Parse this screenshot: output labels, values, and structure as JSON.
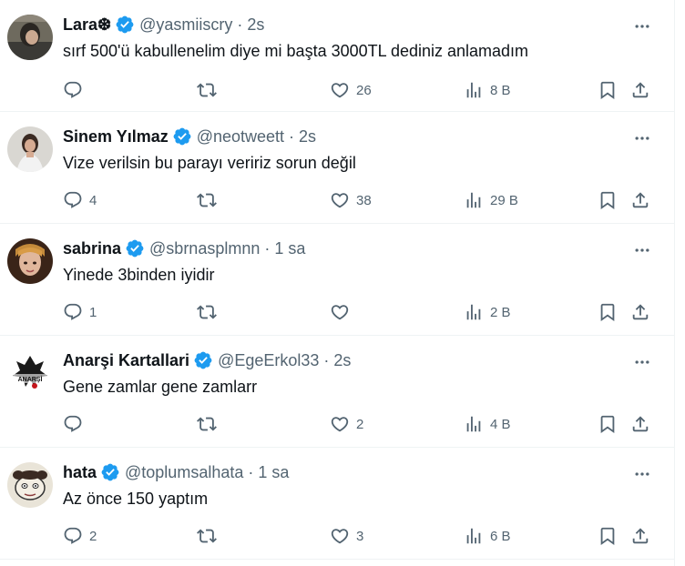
{
  "colors": {
    "text": "#0f1419",
    "secondary": "#536471",
    "verified": "#1d9bf0",
    "divider": "#eff3f4"
  },
  "tweets": [
    {
      "name": "Lara❆",
      "handle": "@yasmiiscry",
      "sep": "·",
      "time": "2s",
      "text": "sırf 500'ü kabullenelim diye mi başta 3000TL dediniz anlamadım",
      "replies": "",
      "retweets": "",
      "likes": "26",
      "views": "8 B"
    },
    {
      "name": "Sinem Yılmaz",
      "handle": "@neotweett",
      "sep": "·",
      "time": "2s",
      "text": "Vize verilsin bu parayı veririz sorun değil",
      "replies": "4",
      "retweets": "",
      "likes": "38",
      "views": "29 B"
    },
    {
      "name": "sabrina",
      "handle": "@sbrnasplmnn",
      "sep": "·",
      "time": "1 sa",
      "text": "Yinede 3binden iyidir",
      "replies": "1",
      "retweets": "",
      "likes": "",
      "views": "2 B"
    },
    {
      "name": "Anarşi Kartallari",
      "handle": "@EgeErkol33",
      "sep": "·",
      "time": "2s",
      "text": "Gene zamlar gene zamlarr",
      "replies": "",
      "retweets": "",
      "likes": "2",
      "views": "4 B"
    },
    {
      "name": "hata",
      "handle": "@toplumsalhata",
      "sep": "·",
      "time": "1 sa",
      "text": "Az önce 150 yaptım",
      "replies": "2",
      "retweets": "",
      "likes": "3",
      "views": "6 B"
    }
  ]
}
